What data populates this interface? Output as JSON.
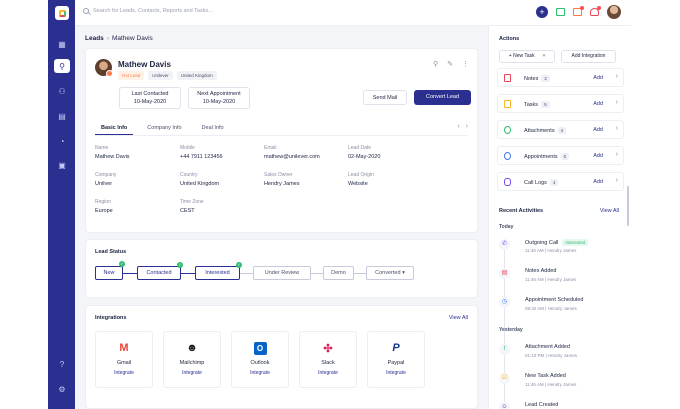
{
  "search": {
    "placeholder": "Search for Leads, Contacts, Reports and Tasks..."
  },
  "breadcrumb": {
    "root": "Leads",
    "current": "Mathew Davis"
  },
  "profile": {
    "name": "Mathew Davis",
    "tags": [
      "Hot Lead",
      "Unilever",
      "United Kingdom"
    ],
    "last_contacted_label": "Last Contacted",
    "last_contacted": "10-May-2020",
    "next_appointment_label": "Next Appointment",
    "next_appointment": "10-May-2020",
    "send_mail": "Send Mail",
    "convert_lead": "Convert Lead"
  },
  "tabs": [
    "Basic Info",
    "Company Info",
    "Deal Info"
  ],
  "fields": [
    {
      "k": "Name",
      "v": "Mathew Davis"
    },
    {
      "k": "Mobile",
      "v": "+44 7911 123456"
    },
    {
      "k": "Email",
      "v": "mathew@unilever.com"
    },
    {
      "k": "Lead Date",
      "v": "02-May-2020"
    },
    {
      "k": "Company",
      "v": "Unilver"
    },
    {
      "k": "Country",
      "v": "United Kingdom"
    },
    {
      "k": "Sales Owner",
      "v": "Hendry James"
    },
    {
      "k": "Lead Origin",
      "v": "Website"
    },
    {
      "k": "Region",
      "v": "Europe"
    },
    {
      "k": "Time Zone",
      "v": "CEST"
    }
  ],
  "lead_status": {
    "title": "Lead Status",
    "steps": [
      "New",
      "Contacted",
      "Interested",
      "Under Review",
      "Demo",
      "Converted"
    ]
  },
  "integrations": {
    "title": "Integrations",
    "view_all": "View All",
    "items": [
      {
        "name": "Gmail",
        "action": "Integrate"
      },
      {
        "name": "Mailchimp",
        "action": "Integrate"
      },
      {
        "name": "Outlook",
        "action": "Integrate"
      },
      {
        "name": "Slack",
        "action": "Integrate"
      },
      {
        "name": "Paypal",
        "action": "Integrate"
      }
    ]
  },
  "actions": {
    "title": "Actions",
    "new_task": "+ New Task",
    "add_integration": "Add Integration",
    "rows": [
      {
        "label": "Notes",
        "count": "2",
        "add": "Add"
      },
      {
        "label": "Tasks",
        "count": "5",
        "add": "Add"
      },
      {
        "label": "Attachments",
        "count": "4",
        "add": "Add"
      },
      {
        "label": "Appointments",
        "count": "0",
        "add": "Add"
      },
      {
        "label": "Call Logs",
        "count": "4",
        "add": "Add"
      }
    ]
  },
  "recent": {
    "title": "Recent Activities",
    "view_all": "View All",
    "today": "Today",
    "yesterday": "Yesterday",
    "items": [
      {
        "title": "Outgoing Call",
        "badge": "Interested",
        "sub": "11:46 AM | Hendry James"
      },
      {
        "title": "Notes Added",
        "sub": "11:46 AM | Hendry James"
      },
      {
        "title": "Appointment Scheduled",
        "sub": "09:32 AM | Hendry James"
      },
      {
        "title": "Attachment Added",
        "sub": "01:10 PM | Hendry James"
      },
      {
        "title": "New Task Added",
        "sub": "11:46 AM | Hendry James"
      },
      {
        "title": "Lead Created",
        "sub": ""
      }
    ]
  },
  "colors": {
    "brand": "#2b2f8f",
    "accent": "#ff7a45",
    "success": "#2fbf71"
  }
}
